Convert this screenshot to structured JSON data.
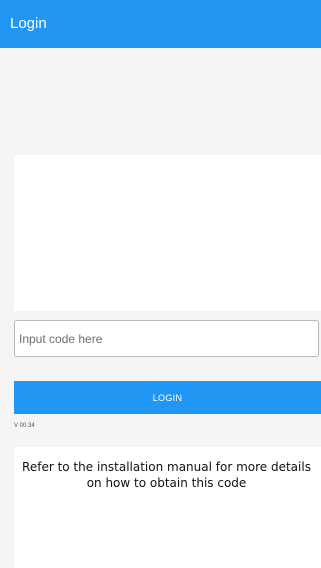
{
  "header": {
    "title": "Login"
  },
  "login_form": {
    "code_input": {
      "value": "",
      "placeholder": "Input code here"
    },
    "login_button_label": "LOGIN",
    "version": "V 00.34"
  },
  "help": {
    "text": "Refer to the installation manual for more details on how to obtain this code"
  },
  "colors": {
    "app_bar": "#2196f3",
    "login_button": "#2196f3",
    "background": "#f5f5f5",
    "panel": "#ffffff"
  }
}
